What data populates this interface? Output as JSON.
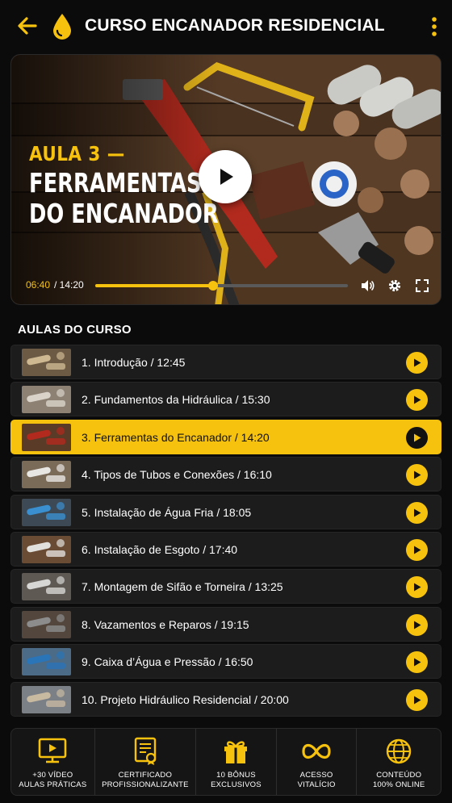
{
  "header": {
    "title": "CURSO ENCANADOR RESIDENCIAL",
    "back_icon": "arrow-left-icon",
    "logo_icon": "water-drop-icon",
    "menu_icon": "more-vertical-icon"
  },
  "video": {
    "kicker": "AULA 3 —",
    "headline_line1": "FERRAMENTAS",
    "headline_line2": "DO ENCANADOR",
    "current_time": "06:40",
    "total_time": "/ 14:20",
    "progress": 0.465
  },
  "section_title": "AULAS DO CURSO",
  "lessons": [
    {
      "label": "1. Introdução / 12:45",
      "active": false
    },
    {
      "label": "2. Fundamentos da Hidráulica / 15:30",
      "active": false
    },
    {
      "label": "3. Ferramentas do Encanador / 14:20",
      "active": true
    },
    {
      "label": "4. Tipos de Tubos e Conexões / 16:10",
      "active": false
    },
    {
      "label": "5. Instalação de Água Fria / 18:05",
      "active": false
    },
    {
      "label": "6. Instalação de Esgoto / 17:40",
      "active": false
    },
    {
      "label": "7. Montagem de Sifão e Torneira / 13:25",
      "active": false
    },
    {
      "label": "8. Vazamentos e Reparos / 19:15",
      "active": false
    },
    {
      "label": "9. Caixa d’Água e Pressão / 16:50",
      "active": false
    },
    {
      "label": "10. Projeto Hidráulico Residencial / 20:00",
      "active": false
    }
  ],
  "features": [
    {
      "line1": "+30 VÍDEO",
      "line2": "AULAS PRÁTICAS",
      "icon": "video-player-icon"
    },
    {
      "line1": "CERTIFICADO",
      "line2": "PROFISSIONALIZANTE",
      "icon": "certificate-icon"
    },
    {
      "line1": "10 BÔNUS",
      "line2": "EXCLUSIVOS",
      "icon": "gift-icon"
    },
    {
      "line1": "ACESSO",
      "line2": "VITALÍCIO",
      "icon": "infinity-icon"
    },
    {
      "line1": "CONTEÚDO",
      "line2": "100% ONLINE",
      "icon": "globe-icon"
    }
  ],
  "colors": {
    "accent": "#f7c20e",
    "background": "#0b0b0b",
    "row": "#1c1c1c"
  }
}
